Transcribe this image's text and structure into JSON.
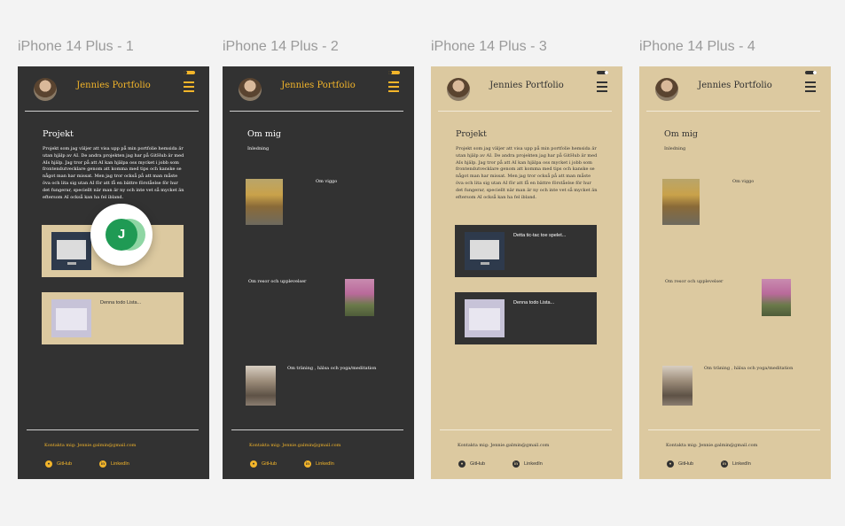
{
  "frames": [
    {
      "label": "iPhone 14 Plus - 1",
      "theme": "dark"
    },
    {
      "label": "iPhone 14 Plus - 2",
      "theme": "dark"
    },
    {
      "label": "iPhone 14 Plus - 3",
      "theme": "light"
    },
    {
      "label": "iPhone 14 Plus - 4",
      "theme": "light"
    }
  ],
  "header": {
    "title": "Jennies Portfolio"
  },
  "projects": {
    "title": "Projekt",
    "text": "Projekt som jag väljer att visa upp på min portfolie hemsida är utan hjälp av AI. De andra projekten jag har på GitHub är med AIs hjälp. Jag tror på att AI kan hjälpa oss mycket i jobb som frontendutvecklare genom att komma med tips och kanske se något man har missat. Men jag tror också på att man måste öva och lita sig utan AI för att få en bättre förståelse för hur det fungerar, speciellt när man är ny och inte vet så mycket än eftersom AI också kan ha fel ibland.",
    "cards": [
      {
        "text": "Detta tic-tac toe spelet..."
      },
      {
        "text": "Denna todo Lista..."
      }
    ]
  },
  "about": {
    "title": "Om mig",
    "intro": "Inledning",
    "items": [
      {
        "caption": "Om viggo"
      },
      {
        "caption": "Om resor och upplevelser"
      },
      {
        "caption": "Om träning , hälsa och yoga/meditation"
      }
    ]
  },
  "footer": {
    "contact": "Kontakta mig:   Jennie.galmin@gmail.com",
    "github": "GitHub",
    "linkedin": "LinkedIn"
  },
  "cursor": {
    "initial": "J"
  },
  "colors": {
    "dark_bg": "#323232",
    "light_bg": "#dcc9a0",
    "accent": "#f3b52a",
    "canvas": "#f3f3f3"
  }
}
